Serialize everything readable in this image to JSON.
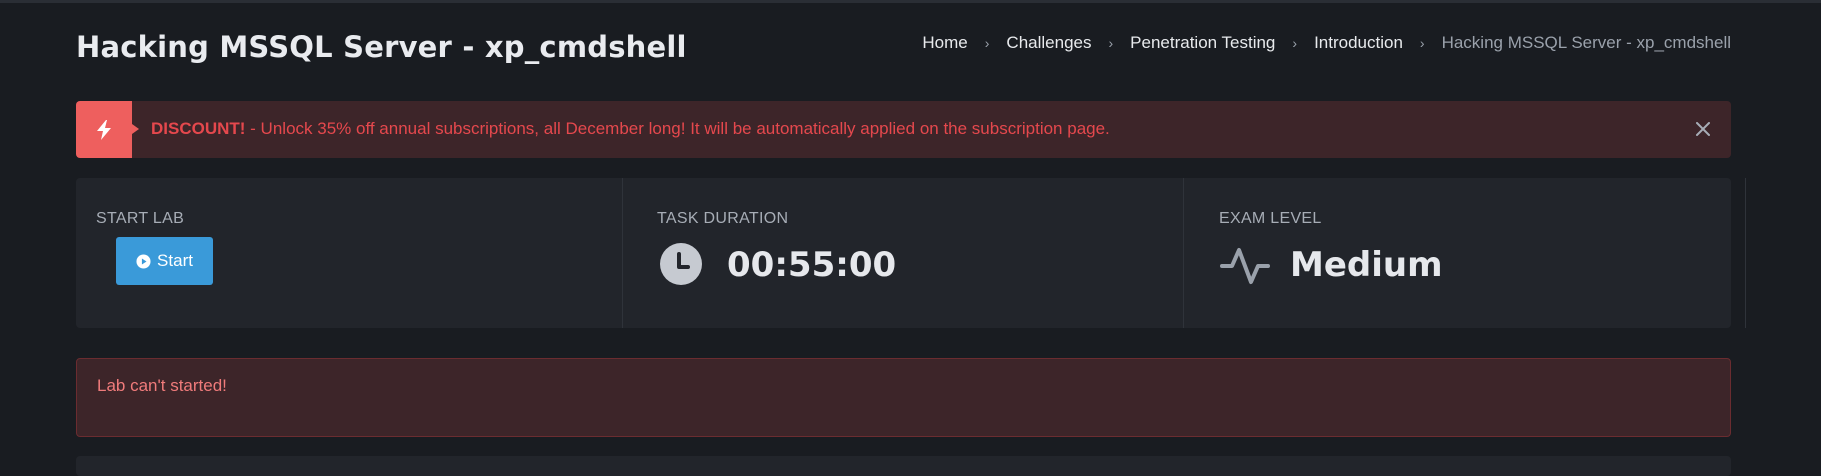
{
  "page": {
    "title": "Hacking MSSQL Server - xp_cmdshell"
  },
  "breadcrumb": {
    "items": [
      {
        "label": "Home"
      },
      {
        "label": "Challenges"
      },
      {
        "label": "Penetration Testing"
      },
      {
        "label": "Introduction"
      },
      {
        "label": "Hacking MSSQL Server - xp_cmdshell"
      }
    ],
    "separator": "›"
  },
  "alert": {
    "icon": "lightning-bolt-icon",
    "bold": "DISCOUNT!",
    "message": " - Unlock 35% off annual subscriptions, all December long! It will be automatically applied on the subscription page.",
    "close_icon": "close-icon"
  },
  "stats": {
    "start_lab": {
      "label": "START LAB",
      "button": "Start",
      "button_icon": "play-circle-icon"
    },
    "task_duration": {
      "label": "TASK DURATION",
      "value": "00:55:00",
      "icon": "clock-icon"
    },
    "exam_level": {
      "label": "EXAM LEVEL",
      "value": "Medium",
      "icon": "activity-pulse-icon"
    }
  },
  "error": {
    "message": "Lab can't started!"
  },
  "colors": {
    "background": "#191c21",
    "card": "#22252b",
    "alert_bg": "#3d2529",
    "alert_accent": "#ee5f5e",
    "alert_text": "#e5484d",
    "primary_button": "#3a9ad9",
    "error_text": "#f07b7b"
  }
}
